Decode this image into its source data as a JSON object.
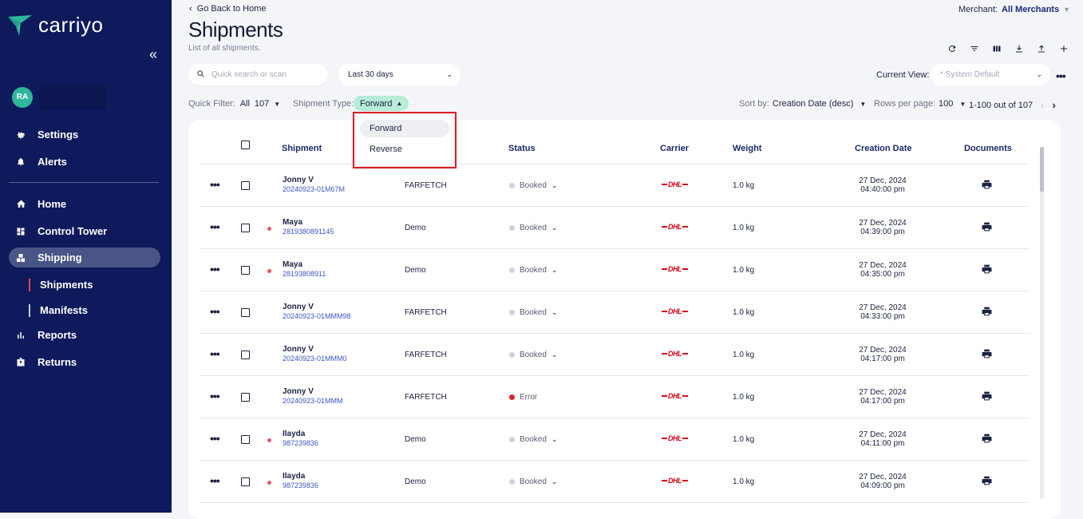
{
  "brand": {
    "name": "carriyo",
    "accent": "#2fb79e"
  },
  "sidebar": {
    "collapse_icon": "double-chevron-left",
    "user_initials": "RA",
    "items": [
      {
        "label": "Settings",
        "icon": "gear-icon"
      },
      {
        "label": "Alerts",
        "icon": "bell-icon"
      },
      {
        "label": "Home",
        "icon": "home-icon"
      },
      {
        "label": "Control Tower",
        "icon": "dashboard-icon"
      },
      {
        "label": "Shipping",
        "icon": "boxes-icon"
      },
      {
        "label": "Reports",
        "icon": "bar-chart-icon"
      },
      {
        "label": "Returns",
        "icon": "return-box-icon"
      }
    ],
    "subitems": [
      {
        "label": "Shipments"
      },
      {
        "label": "Manifests"
      }
    ]
  },
  "header": {
    "back_label": "Go Back to Home",
    "title": "Shipments",
    "subtitle": "List of all shipments.",
    "merchant_label": "Merchant:",
    "merchant_value": "All Merchants"
  },
  "filters": {
    "search_placeholder": "Quick search or scan",
    "date_range": "Last 30 days",
    "current_view_label": "Current View:",
    "current_view_value": "* System Default",
    "quick_filter_label": "Quick Filter:",
    "quick_filter_value": "All",
    "quick_filter_count": "107",
    "shipment_type_label": "Shipment Type:",
    "shipment_type_value": "Forward",
    "sort_label": "Sort by:",
    "sort_value": "Creation Date (desc)",
    "rows_label": "Rows per page:",
    "rows_value": "100",
    "range_text": "1-100 out of 107"
  },
  "dropdown": {
    "options": [
      "Forward",
      "Reverse"
    ]
  },
  "table": {
    "headers": [
      "Shipment",
      "Status",
      "Carrier",
      "Weight",
      "Creation Date",
      "Documents"
    ],
    "rows": [
      {
        "name": "Jonny V",
        "id": "20240923-01M67M",
        "merchant": "FARFETCH",
        "status": "Booked",
        "carrier": "DHL",
        "weight": "1.0 kg",
        "date": "27 Dec, 2024",
        "time": "04:40:00 pm",
        "flag": false
      },
      {
        "name": "Maya",
        "id": "2819380891145",
        "merchant": "Demo",
        "status": "Booked",
        "carrier": "DHL",
        "weight": "1.0 kg",
        "date": "27 Dec, 2024",
        "time": "04:39:00 pm",
        "flag": true
      },
      {
        "name": "Maya",
        "id": "28193808911",
        "merchant": "Demo",
        "status": "Booked",
        "carrier": "DHL",
        "weight": "1.0 kg",
        "date": "27 Dec, 2024",
        "time": "04:35:00 pm",
        "flag": true
      },
      {
        "name": "Jonny V",
        "id": "20240923-01MMM98",
        "merchant": "FARFETCH",
        "status": "Booked",
        "carrier": "DHL",
        "weight": "1.0 kg",
        "date": "27 Dec, 2024",
        "time": "04:33:00 pm",
        "flag": false
      },
      {
        "name": "Jonny V",
        "id": "20240923-01MMM0",
        "merchant": "FARFETCH",
        "status": "Booked",
        "carrier": "DHL",
        "weight": "1.0 kg",
        "date": "27 Dec, 2024",
        "time": "04:17:00 pm",
        "flag": false
      },
      {
        "name": "Jonny V",
        "id": "20240923-01MMM",
        "merchant": "FARFETCH",
        "status": "Error",
        "carrier": "DHL",
        "weight": "1.0 kg",
        "date": "27 Dec, 2024",
        "time": "04:17:00 pm",
        "flag": false
      },
      {
        "name": "Ilayda",
        "id": "987239836",
        "merchant": "Demo",
        "status": "Booked",
        "carrier": "DHL",
        "weight": "1.0 kg",
        "date": "27 Dec, 2024",
        "time": "04:11:00 pm",
        "flag": true
      },
      {
        "name": "Ilayda",
        "id": "987239836",
        "merchant": "Demo",
        "status": "Booked",
        "carrier": "DHL",
        "weight": "1.0 kg",
        "date": "27 Dec, 2024",
        "time": "04:09:00 pm",
        "flag": true
      }
    ]
  }
}
